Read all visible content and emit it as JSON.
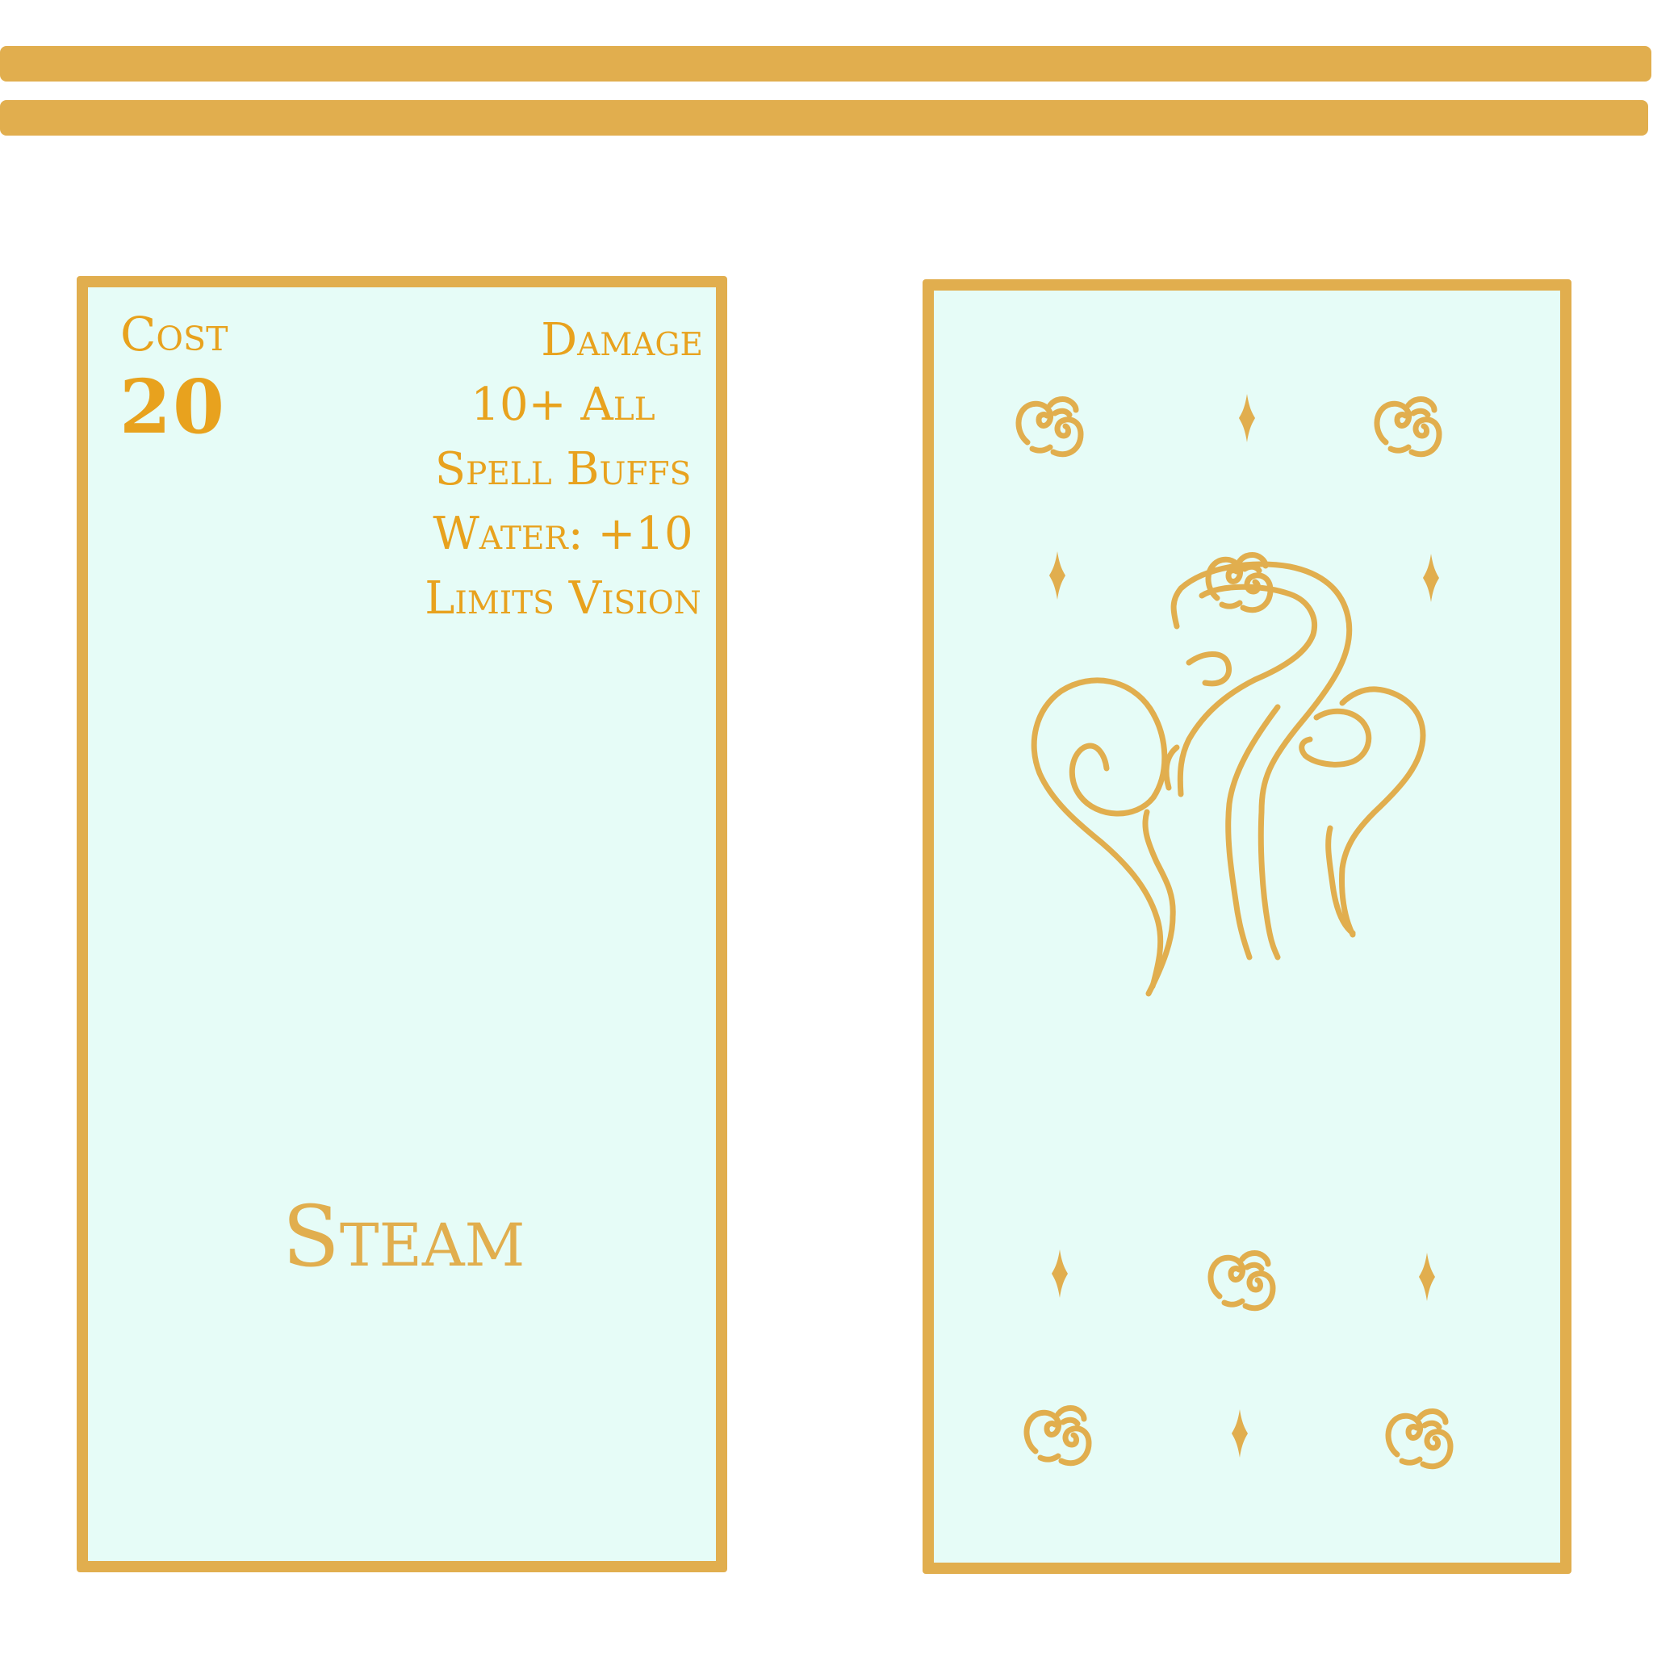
{
  "colors": {
    "gold": "#E1AE4E",
    "text_gold": "#E8A21E",
    "card_fill": "#E6FCF7",
    "background": "#FFFFFF"
  },
  "card_front": {
    "cost_label": "Cost",
    "cost_value": "20",
    "stats": {
      "damage_label": "Damage",
      "damage_value": "10+ All",
      "spell_buffs_label": "Spell Buffs",
      "water_buff": "Water: +10",
      "effect": "Limits Vision"
    },
    "name": "Steam"
  },
  "card_back": {
    "center_icon": "steam-swirl-icon",
    "corner_icons": [
      "cloud-icon",
      "sparkle-icon"
    ]
  }
}
